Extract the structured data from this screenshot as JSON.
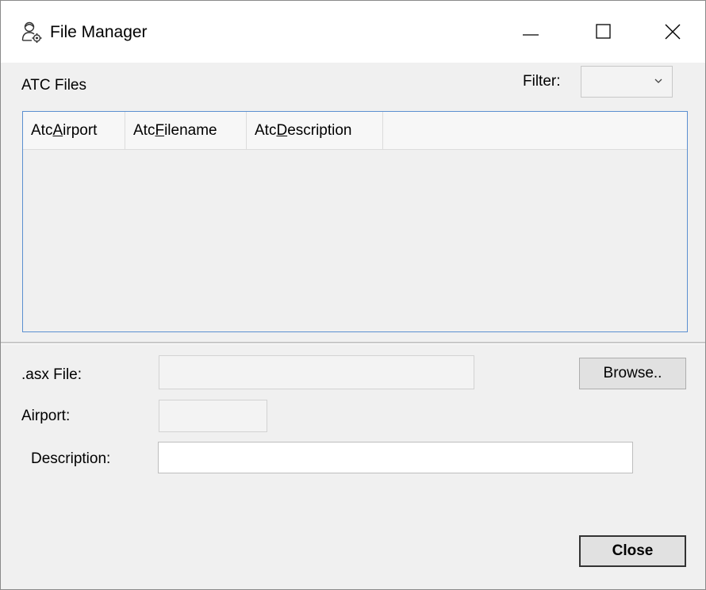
{
  "window": {
    "title": "File Manager",
    "icon": "admin-user-gear-icon",
    "controls": {
      "minimize": "minimize-icon",
      "maximize": "maximize-icon",
      "close": "close-icon"
    }
  },
  "files_section": {
    "label": "ATC Files",
    "filter_label": "Filter:",
    "filter_value": ""
  },
  "grid": {
    "columns": [
      {
        "prefix": "Atc",
        "accel": "A",
        "rest": "irport"
      },
      {
        "prefix": "Atc",
        "accel": "F",
        "rest": "ilename"
      },
      {
        "prefix": "Atc",
        "accel": "D",
        "rest": "escription"
      }
    ],
    "rows": []
  },
  "form": {
    "asx_label": ".asx File:",
    "asx_value": "",
    "airport_label": "Airport:",
    "airport_value": "",
    "description_label": "Description:",
    "description_value": ""
  },
  "buttons": {
    "browse": "Browse..",
    "close": "Close"
  },
  "colors": {
    "grid_border": "#5b8fd0",
    "window_bg": "#f0f0f0",
    "button_bg": "#e1e1e1"
  }
}
